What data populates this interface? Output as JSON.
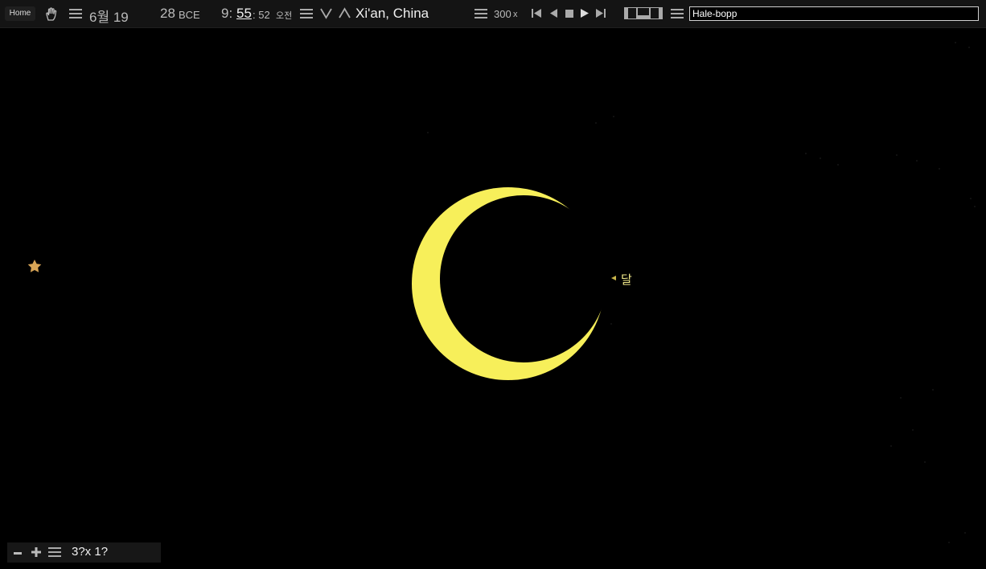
{
  "toolbar": {
    "home_label": "Home",
    "month_day": "6월 19",
    "year": "28",
    "era": "BCE",
    "hour": "9:",
    "minute": "55",
    "second": ": 52",
    "ampm": "오전",
    "location": "Xi'an, China",
    "speed_value": "300",
    "speed_unit": "x",
    "search_value": "Hale-bopp"
  },
  "sky": {
    "moon_label": "달",
    "moon_color": "#f7ef5a",
    "star_color": "#d9a556"
  },
  "bottom": {
    "zoom_readout": "3?x 1?"
  }
}
